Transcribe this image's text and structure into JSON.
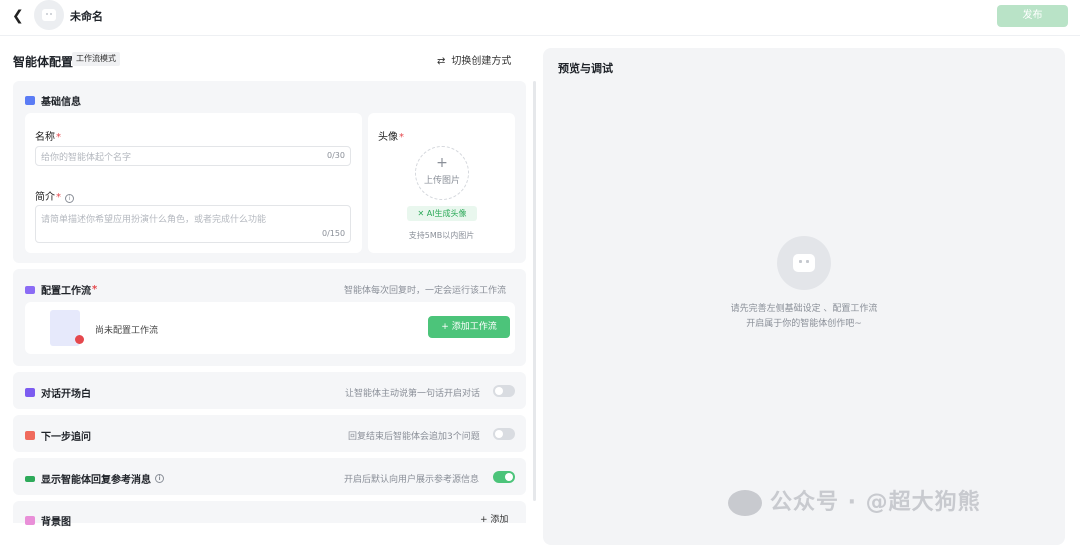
{
  "header": {
    "back_icon": "chevron-left-icon",
    "app_name": "未命名",
    "publish_label": "发布"
  },
  "config": {
    "title": "智能体配置",
    "mode_tag": "工作流模式",
    "switch_label": "切换创建方式"
  },
  "basic": {
    "title": "基础信息",
    "name_label": "名称",
    "name_placeholder": "给你的智能体起个名字",
    "name_count": "0/30",
    "intro_label": "简介",
    "intro_placeholder": "请简单描述你希望应用扮演什么角色，或者完成什么功能",
    "intro_count": "0/150",
    "avatar_label": "头像",
    "upload_label": "上传图片",
    "ai_avatar_label": "AI生成头像",
    "support_text": "支持5MB以内图片"
  },
  "workflow": {
    "title": "配置工作流",
    "desc": "智能体每次回复时，一定会运行该工作流",
    "empty_text": "尚未配置工作流",
    "add_label": "添加工作流"
  },
  "opening": {
    "title": "对话开场白",
    "desc": "让智能体主动说第一句话开启对话",
    "enabled": false
  },
  "next_step": {
    "title": "下一步追问",
    "desc": "回复结束后智能体会追加3个问题",
    "enabled": false
  },
  "show_ref": {
    "title": "显示智能体回复参考消息",
    "desc": "开启后默认向用户展示参考源信息",
    "enabled": true
  },
  "background": {
    "title": "背景图",
    "add_label": "添加"
  },
  "preview": {
    "title": "预览与调试",
    "hint_line1": "请先完善左侧基础设定 、配置工作流",
    "hint_line2": "开启属于你的智能体创作吧~"
  },
  "watermark": {
    "text": "公众号 · @超大狗熊"
  },
  "colors": {
    "accent": "#4cc47a",
    "publish_disabled": "#b9e3c7",
    "required": "#e5484d"
  }
}
